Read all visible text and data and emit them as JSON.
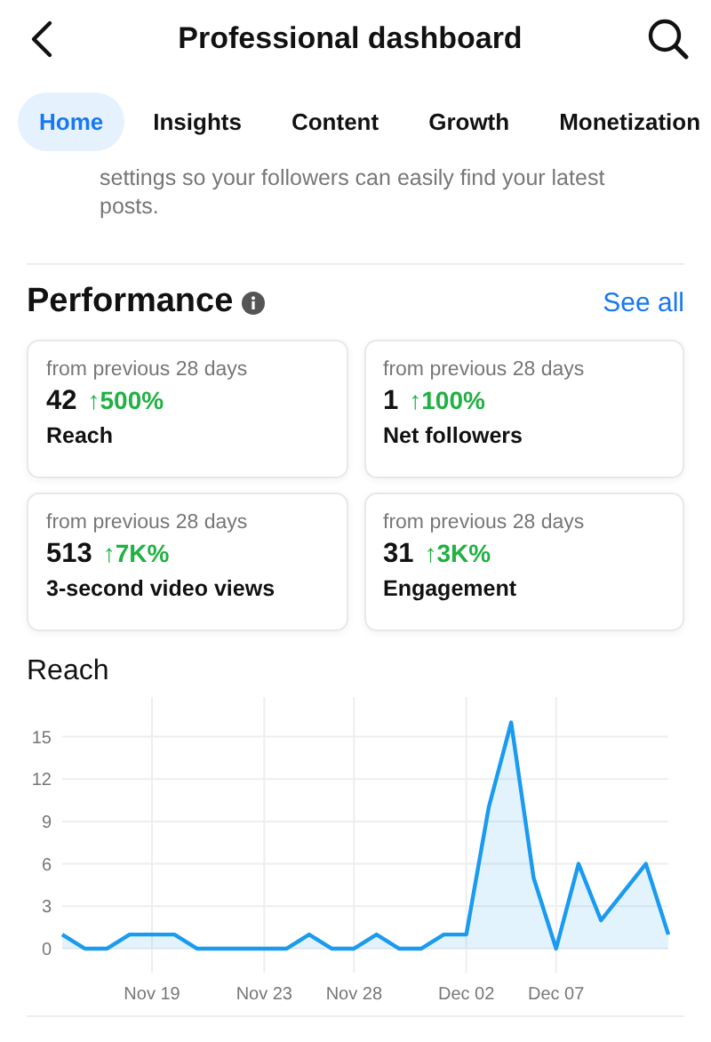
{
  "header": {
    "title": "Professional dashboard"
  },
  "tabs": [
    {
      "label": "Home",
      "selected": true
    },
    {
      "label": "Insights",
      "selected": false
    },
    {
      "label": "Content",
      "selected": false
    },
    {
      "label": "Growth",
      "selected": false
    },
    {
      "label": "Monetization",
      "selected": false
    }
  ],
  "notice": {
    "text": "settings so your followers can easily find your latest posts."
  },
  "performance": {
    "title": "Performance",
    "link": "See all",
    "cards": [
      {
        "period": "from previous 28 days",
        "value": "42",
        "change": "↑500%",
        "label": "Reach"
      },
      {
        "period": "from previous 28 days",
        "value": "1",
        "change": "↑100%",
        "label": "Net followers"
      },
      {
        "period": "from previous 28 days",
        "value": "513",
        "change": "↑7K%",
        "label": "3-second video views"
      },
      {
        "period": "from previous 28 days",
        "value": "31",
        "change": "↑3K%",
        "label": "Engagement"
      }
    ]
  },
  "reach": {
    "chart_data": {
      "type": "area",
      "title": "Reach",
      "categories": [
        null,
        null,
        null,
        null,
        "Nov 19",
        null,
        null,
        null,
        null,
        "Nov 23",
        null,
        null,
        null,
        "Nov 28",
        null,
        null,
        null,
        null,
        "Dec 02",
        null,
        null,
        null,
        "Dec 07",
        null,
        null,
        null,
        null,
        null
      ],
      "series": [
        {
          "color": "#1a9bf0",
          "values": [
            1,
            0,
            0,
            1,
            1,
            1,
            0,
            0,
            0,
            0,
            0,
            1,
            0,
            0,
            1,
            0,
            0,
            1,
            1,
            10,
            16,
            5,
            0,
            6,
            2,
            4,
            6,
            1
          ]
        }
      ],
      "ylim": [
        -1.7,
        17.8
      ],
      "grid": true,
      "yticks": [
        0,
        3,
        6,
        9,
        12,
        15
      ]
    }
  }
}
